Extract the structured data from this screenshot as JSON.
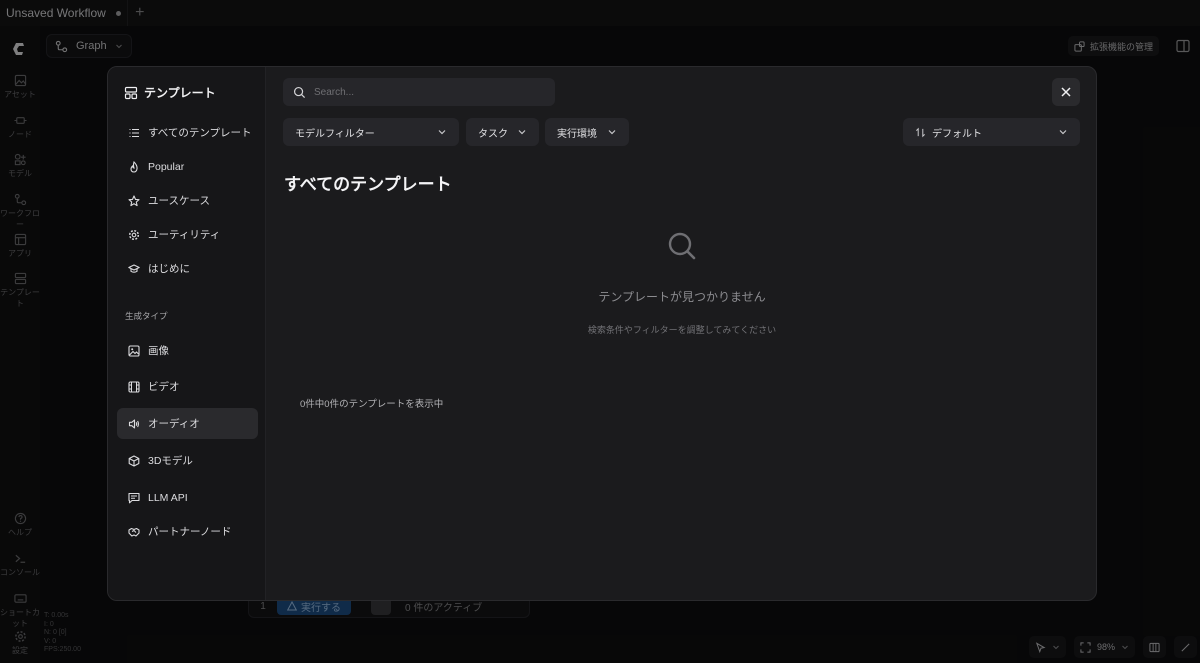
{
  "tabs": [
    {
      "label": "Unsaved Workflow"
    }
  ],
  "toolbar": {
    "graph_label": "Graph",
    "extensions_label": "拡張機能の管理"
  },
  "rail": {
    "items": [
      {
        "label": "アセット"
      },
      {
        "label": "ノード"
      },
      {
        "label": "モデル"
      },
      {
        "label": "ワークフロー"
      },
      {
        "label": "アプリ"
      },
      {
        "label": "テンプレート"
      }
    ],
    "bottom": [
      {
        "label": "ヘルプ"
      },
      {
        "label": "コンソール"
      },
      {
        "label": "ショートカット"
      },
      {
        "label": "設定"
      }
    ],
    "stats": [
      "T: 0.00s",
      "I: 0",
      "N: 0 [0]",
      "V: 0",
      "FPS:250.00"
    ]
  },
  "runbar": {
    "number": "1",
    "run_label": "実行する",
    "active_label": "0 件のアクティブ"
  },
  "zoom": {
    "level": "98%"
  },
  "modal": {
    "title": "テンプレート",
    "nav": [
      {
        "label": "すべてのテンプレート",
        "icon": "list-icon"
      },
      {
        "label": "Popular",
        "icon": "flame-icon"
      },
      {
        "label": "ユースケース",
        "icon": "star-icon"
      },
      {
        "label": "ユーティリティ",
        "icon": "gear-icon"
      },
      {
        "label": "はじめに",
        "icon": "graduation-cap-icon"
      }
    ],
    "section_label": "生成タイプ",
    "types": [
      {
        "label": "画像",
        "icon": "image-icon"
      },
      {
        "label": "ビデオ",
        "icon": "film-icon"
      },
      {
        "label": "オーディオ",
        "icon": "speaker-icon",
        "active": true
      },
      {
        "label": "3Dモデル",
        "icon": "cube-icon"
      },
      {
        "label": "LLM API",
        "icon": "chat-icon"
      },
      {
        "label": "パートナーノード",
        "icon": "handshake-icon"
      }
    ],
    "search_placeholder": "Search...",
    "filters": {
      "model": "モデルフィルター",
      "task": "タスク",
      "runtime": "実行環境",
      "sort": "デフォルト"
    },
    "heading": "すべてのテンプレート",
    "empty_title": "テンプレートが見つかりません",
    "empty_subtitle": "検索条件やフィルターを調整してみてください",
    "count_text": "0件中0件のテンプレートを表示中"
  }
}
